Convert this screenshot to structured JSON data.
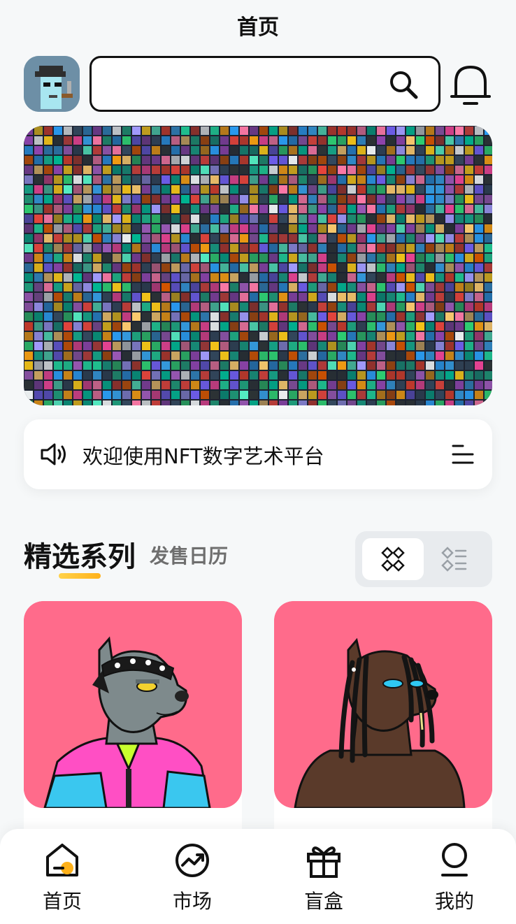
{
  "header": {
    "title": "首页",
    "search": {
      "value": "",
      "icon": "search-icon"
    },
    "notification_icon": "bell-icon",
    "avatar_icon": "pixel-punk-avatar"
  },
  "banner": {
    "image": "nft-mosaic-collage"
  },
  "notice": {
    "icon": "speaker-icon",
    "text": "欢迎使用NFT数字艺术平台",
    "menu_icon": "menu-icon"
  },
  "section": {
    "tabs": [
      {
        "label": "精选系列",
        "active": true
      },
      {
        "label": "发售日历",
        "active": false
      }
    ],
    "view_modes": [
      {
        "icon": "grid-view-icon",
        "active": true
      },
      {
        "icon": "list-view-icon",
        "active": false
      }
    ]
  },
  "cards": [
    {
      "image": "gray-dog-bandana-art",
      "bg": "#ff6b8b"
    },
    {
      "image": "brown-dog-dreadlocks-art",
      "bg": "#ff6b8b"
    }
  ],
  "bottom_nav": [
    {
      "label": "首页",
      "icon": "home-icon",
      "active": true
    },
    {
      "label": "市场",
      "icon": "trend-icon",
      "active": false
    },
    {
      "label": "盲盒",
      "icon": "gift-icon",
      "active": false
    },
    {
      "label": "我的",
      "icon": "profile-icon",
      "active": false
    }
  ],
  "colors": {
    "accent": "#ffb11a",
    "card_bg": "#ff6b8b",
    "page_bg": "#f6f8f9"
  }
}
